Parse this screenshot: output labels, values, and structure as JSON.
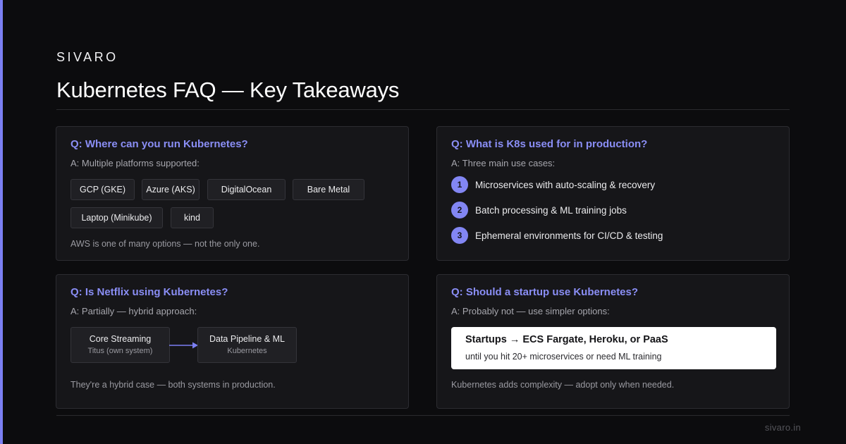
{
  "brand": "SIVARO",
  "title": "Kubernetes FAQ — Key Takeaways",
  "cards": {
    "platforms": {
      "question": "Q: Where can you run Kubernetes?",
      "answer": "A: Multiple platforms supported:",
      "chips": [
        "GCP (GKE)",
        "Azure (AKS)",
        "DigitalOcean",
        "Bare Metal",
        "Laptop (Minikube)",
        "kind"
      ],
      "note": "AWS is one of many options — not the only one."
    },
    "production": {
      "question": "Q: What is K8s used for in production?",
      "answer": "A: Three main use cases:",
      "uses": [
        {
          "num": "1",
          "text": "Microservices with auto-scaling & recovery"
        },
        {
          "num": "2",
          "text": "Batch processing & ML training jobs"
        },
        {
          "num": "3",
          "text": "Ephemeral environments for CI/CD & testing"
        }
      ]
    },
    "netflix": {
      "question": "Q: Is Netflix using Kubernetes?",
      "answer": "A: Partially — hybrid approach:",
      "nodes": [
        {
          "title": "Core Streaming",
          "sub": "Titus (own system)"
        },
        {
          "title": "Data Pipeline & ML",
          "sub": "Kubernetes"
        }
      ],
      "note": "They're a hybrid case — both systems in production."
    },
    "startup": {
      "question": "Q: Should a startup use Kubernetes?",
      "answer": "A: Probably not — use simpler options:",
      "callout_main": "Startups → ECS Fargate, Heroku, or PaaS",
      "callout_sub": "until you hit 20+ microservices or need ML training",
      "note": "Kubernetes adds complexity — adopt only when needed."
    }
  },
  "footer": "sivaro.in",
  "colors": {
    "accent": "#7b7ff2",
    "question": "#8a8ef5",
    "background": "#0c0c0e",
    "card": "#161619"
  }
}
